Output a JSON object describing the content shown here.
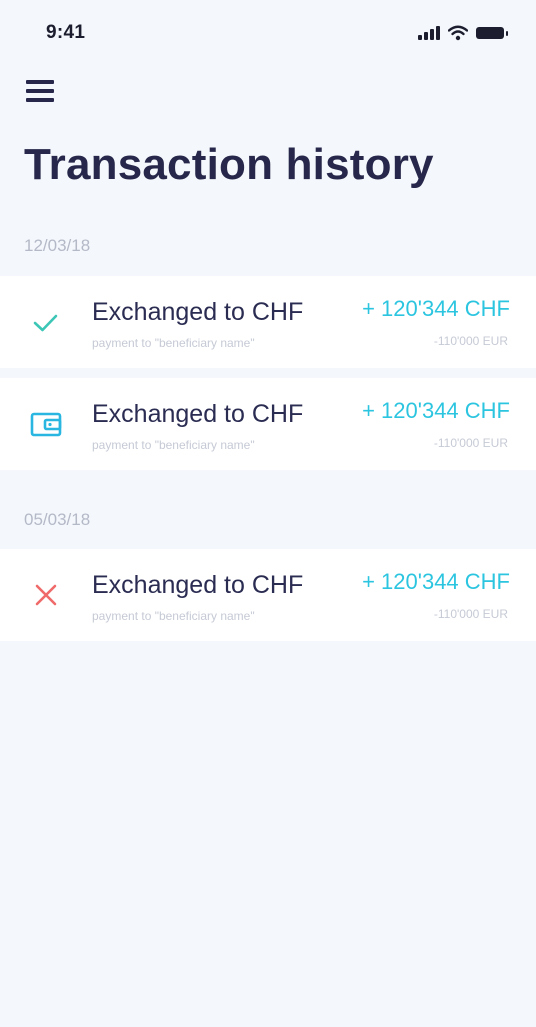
{
  "status_bar": {
    "time": "9:41"
  },
  "header": {
    "title": "Transaction history"
  },
  "colors": {
    "background": "#f4f7fb",
    "card": "#ffffff",
    "title_text": "#26274a",
    "accent_amount": "#2cc5e0",
    "success_check": "#3cc6b6",
    "wallet_icon": "#29b6e0",
    "error_cross": "#f06a6a",
    "muted_text": "#c6cad5"
  },
  "groups": [
    {
      "date": "12/03/18",
      "transactions": [
        {
          "icon": "check-icon",
          "title": "Exchanged to CHF",
          "subtitle": "payment to \"beneficiary name\"",
          "amount": "+ 120'344 CHF",
          "original": "-110'000 EUR"
        },
        {
          "icon": "wallet-icon",
          "title": "Exchanged to CHF",
          "subtitle": "payment to \"beneficiary name\"",
          "amount": "+ 120'344 CHF",
          "original": "-110'000 EUR"
        }
      ]
    },
    {
      "date": "05/03/18",
      "transactions": [
        {
          "icon": "close-icon",
          "title": "Exchanged to CHF",
          "subtitle": "payment to \"beneficiary name\"",
          "amount": "+ 120'344 CHF",
          "original": "-110'000 EUR"
        }
      ]
    }
  ]
}
